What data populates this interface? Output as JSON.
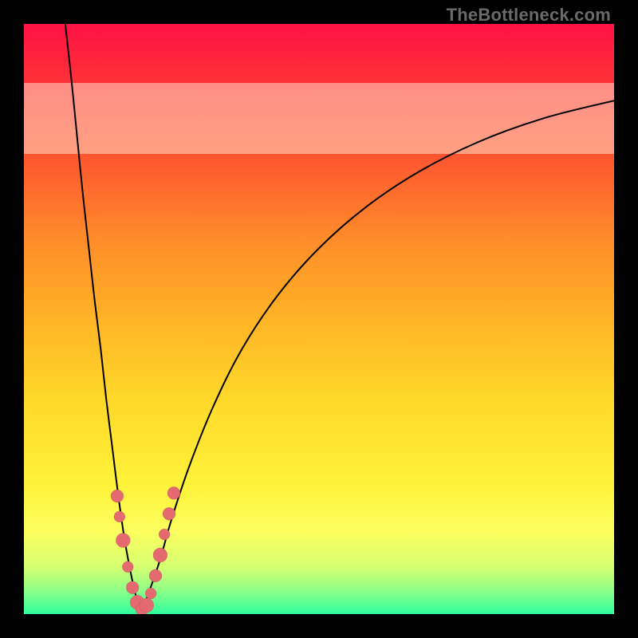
{
  "watermark": "TheBottleneck.com",
  "chart_data": {
    "type": "line",
    "title": "",
    "xlabel": "",
    "ylabel": "",
    "xlim": [
      0,
      100
    ],
    "ylim": [
      0,
      100
    ],
    "pale_band": {
      "from_y": 78,
      "to_y": 90
    },
    "series": [
      {
        "name": "left-curve",
        "x": [
          7.0,
          8.0,
          9.0,
          10.0,
          11.0,
          12.0,
          13.0,
          14.0,
          15.0,
          16.0,
          17.0,
          18.0,
          19.0,
          20.0
        ],
        "y": [
          100,
          91,
          81,
          71,
          62,
          53,
          45,
          36,
          28,
          20,
          13,
          7.5,
          3.0,
          0.5
        ]
      },
      {
        "name": "right-curve",
        "x": [
          20.0,
          21.0,
          23.0,
          25.0,
          28.0,
          32.0,
          37.0,
          43.0,
          50.0,
          58.0,
          67.0,
          77.0,
          88.0,
          100.0
        ],
        "y": [
          0.5,
          3.2,
          9.0,
          16.0,
          25.0,
          35.0,
          45.0,
          54.0,
          62.0,
          69.0,
          75.0,
          80.0,
          84.0,
          87.0
        ]
      }
    ],
    "markers": {
      "name": "valley-points",
      "color": "#e46a70",
      "points": [
        {
          "x": 15.8,
          "y": 20.0,
          "r": 8
        },
        {
          "x": 16.2,
          "y": 16.5,
          "r": 7
        },
        {
          "x": 16.8,
          "y": 12.5,
          "r": 9
        },
        {
          "x": 17.6,
          "y": 8.0,
          "r": 7
        },
        {
          "x": 18.4,
          "y": 4.5,
          "r": 8
        },
        {
          "x": 19.2,
          "y": 2.0,
          "r": 9
        },
        {
          "x": 20.0,
          "y": 0.8,
          "r": 8
        },
        {
          "x": 20.8,
          "y": 1.5,
          "r": 9
        },
        {
          "x": 21.5,
          "y": 3.5,
          "r": 7
        },
        {
          "x": 22.3,
          "y": 6.5,
          "r": 8
        },
        {
          "x": 23.1,
          "y": 10.0,
          "r": 9
        },
        {
          "x": 23.8,
          "y": 13.5,
          "r": 7
        },
        {
          "x": 24.6,
          "y": 17.0,
          "r": 8
        },
        {
          "x": 25.4,
          "y": 20.5,
          "r": 8
        }
      ]
    }
  }
}
